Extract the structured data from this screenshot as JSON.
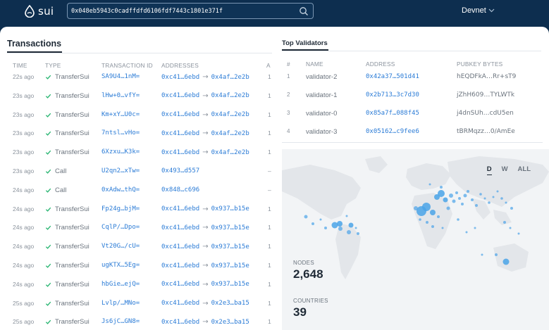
{
  "header": {
    "brand": "sui",
    "search_value": "0x048eb5943c0cadffdfd6106fdf7443c1801e371f",
    "network": "Devnet"
  },
  "transactions": {
    "title": "Transactions",
    "columns": [
      "TIME",
      "TYPE",
      "TRANSACTION ID",
      "ADDRESSES",
      "A"
    ],
    "rows": [
      {
        "time": "22s ago",
        "type": "TransferSui",
        "id": "SA9U4…1nM=",
        "from": "0xc41…6ebd",
        "to": "0x4af…2e2b",
        "amount": "1"
      },
      {
        "time": "23s ago",
        "type": "TransferSui",
        "id": "lHw+0…vfY=",
        "from": "0xc41…6ebd",
        "to": "0x4af…2e2b",
        "amount": "1"
      },
      {
        "time": "23s ago",
        "type": "TransferSui",
        "id": "Km+xY…U0c=",
        "from": "0xc41…6ebd",
        "to": "0x4af…2e2b",
        "amount": "1"
      },
      {
        "time": "23s ago",
        "type": "TransferSui",
        "id": "7ntsl…vHo=",
        "from": "0xc41…6ebd",
        "to": "0x4af…2e2b",
        "amount": "1"
      },
      {
        "time": "23s ago",
        "type": "TransferSui",
        "id": "6Xzxu…K3k=",
        "from": "0xc41…6ebd",
        "to": "0x4af…2e2b",
        "amount": "1"
      },
      {
        "time": "23s ago",
        "type": "Call",
        "id": "U2qn2…xTw=",
        "from": "0x493…d557",
        "to": "",
        "amount": "–"
      },
      {
        "time": "24s ago",
        "type": "Call",
        "id": "0xAdw…thQ=",
        "from": "0x848…c696",
        "to": "",
        "amount": "–"
      },
      {
        "time": "24s ago",
        "type": "TransferSui",
        "id": "Fp24g…bjM=",
        "from": "0xc41…6ebd",
        "to": "0x937…b15e",
        "amount": "1"
      },
      {
        "time": "24s ago",
        "type": "TransferSui",
        "id": "CqlP/…Dpo=",
        "from": "0xc41…6ebd",
        "to": "0x937…b15e",
        "amount": "1"
      },
      {
        "time": "24s ago",
        "type": "TransferSui",
        "id": "Vt20G…/cU=",
        "from": "0xc41…6ebd",
        "to": "0x937…b15e",
        "amount": "1"
      },
      {
        "time": "24s ago",
        "type": "TransferSui",
        "id": "ugKTX…5Eg=",
        "from": "0xc41…6ebd",
        "to": "0x937…b15e",
        "amount": "1"
      },
      {
        "time": "24s ago",
        "type": "TransferSui",
        "id": "hbGie…ejQ=",
        "from": "0xc41…6ebd",
        "to": "0x937…b15e",
        "amount": "1"
      },
      {
        "time": "25s ago",
        "type": "TransferSui",
        "id": "Lvlp/…MNo=",
        "from": "0xc41…6ebd",
        "to": "0x2e3…ba15",
        "amount": "1"
      },
      {
        "time": "25s ago",
        "type": "TransferSui",
        "id": "Js6jC…GN8=",
        "from": "0xc41…6ebd",
        "to": "0x2e3…ba15",
        "amount": "1"
      }
    ]
  },
  "validators": {
    "title": "Top Validators",
    "columns": [
      "#",
      "NAME",
      "ADDRESS",
      "PUBKEY BYTES"
    ],
    "rows": [
      {
        "rank": "1",
        "name": "validator-2",
        "address": "0x42a37…501d41",
        "pubkey": "hEQDFkA…Rr+sT9"
      },
      {
        "rank": "2",
        "name": "validator-1",
        "address": "0x2b713…3c7d30",
        "pubkey": "jZhH609…TYLWTk"
      },
      {
        "rank": "3",
        "name": "validator-0",
        "address": "0x85a7f…088f45",
        "pubkey": "j4dnSUh…cdU5en"
      },
      {
        "rank": "4",
        "name": "validator-3",
        "address": "0x05162…c9fee6",
        "pubkey": "tBRMqzz…0/AmEe"
      }
    ]
  },
  "map": {
    "tabs": [
      "D",
      "W",
      "ALL"
    ],
    "active_tab": "D",
    "nodes_label": "NODES",
    "nodes_value": "2,648",
    "countries_label": "COUNTRIES",
    "countries_value": "39"
  },
  "colors": {
    "header_bg": "#0d2e4f",
    "link": "#2a7bd6",
    "success": "#2bb673",
    "map_land": "#e3e6ea",
    "map_node": "#4aa3e8"
  }
}
